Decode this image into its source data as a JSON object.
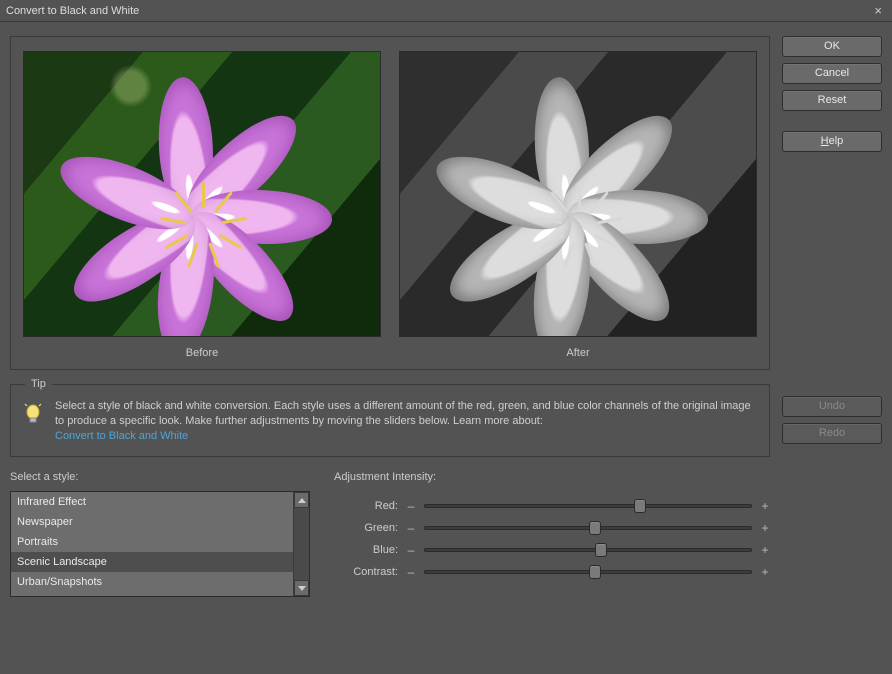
{
  "title": "Convert to Black and White",
  "buttons": {
    "ok": "OK",
    "cancel": "Cancel",
    "reset": "Reset",
    "help": "elp",
    "help_mnemonic": "H",
    "undo": "Undo",
    "redo": "Redo"
  },
  "preview": {
    "before_label": "Before",
    "after_label": "After"
  },
  "tip": {
    "legend": "Tip",
    "text": "Select a style of black and white conversion. Each style uses a different amount of the red, green, and blue color channels of the original image to produce a specific look. Make further adjustments by moving the sliders below. Learn more about: ",
    "link_text": "Convert to Black and White"
  },
  "styles": {
    "label": "Select a style:",
    "items": [
      "Infrared Effect",
      "Newspaper",
      "Portraits",
      "Scenic Landscape",
      "Urban/Snapshots"
    ],
    "selected_index": 3
  },
  "adjust": {
    "title": "Adjustment Intensity:",
    "sliders": [
      {
        "label": "Red:",
        "pos": 66
      },
      {
        "label": "Green:",
        "pos": 52
      },
      {
        "label": "Blue:",
        "pos": 54
      },
      {
        "label": "Contrast:",
        "pos": 52
      }
    ]
  }
}
